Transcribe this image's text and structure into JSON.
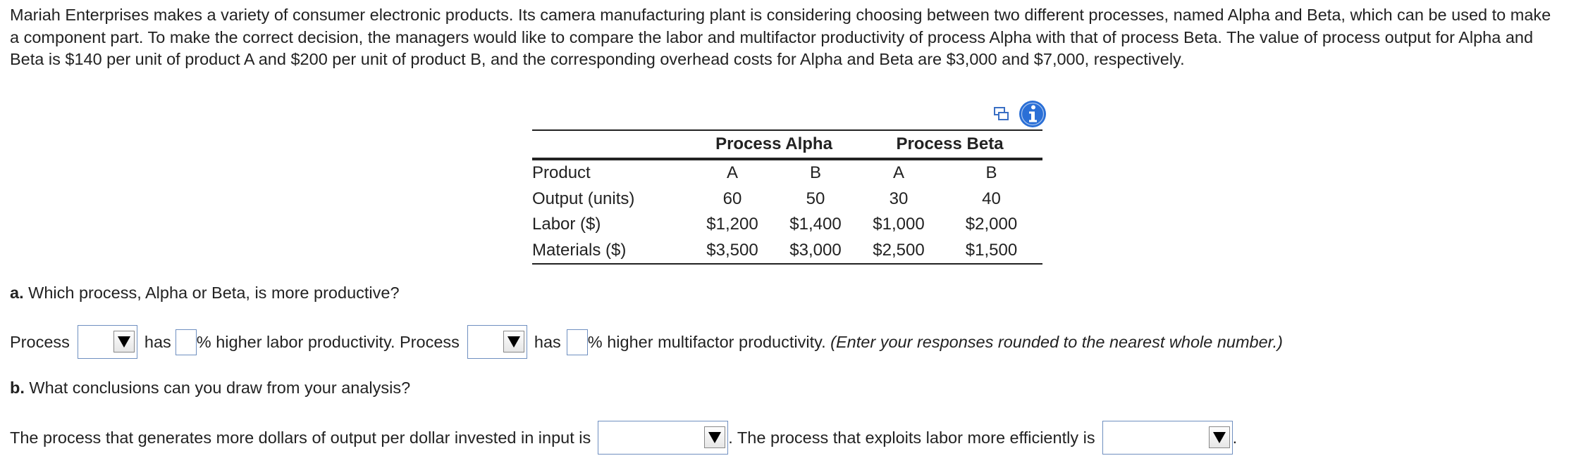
{
  "problem": {
    "text": "Mariah Enterprises makes a variety of consumer electronic products. Its camera manufacturing plant is considering choosing between two different processes, named Alpha and Beta, which can be used to make a component part. To make the correct decision, the managers would like to compare the labor and multifactor productivity of process Alpha with that of process Beta. The value of process output for Alpha and Beta is $140 per unit of product A and $200 per unit of product B, and the corresponding overhead costs for Alpha and Beta are $3,000 and $7,000, respectively."
  },
  "icons": {
    "copy": "copy-icon",
    "info": "info-icon",
    "info_color": "#2a6fd6"
  },
  "table": {
    "group_headers": [
      "Process Alpha",
      "Process Beta"
    ],
    "rows": [
      {
        "label": "Product",
        "values": [
          "A",
          "B",
          "A",
          "B"
        ]
      },
      {
        "label": "Output (units)",
        "values": [
          "60",
          "50",
          "30",
          "40"
        ]
      },
      {
        "label": "Labor ($)",
        "values": [
          "$1,200",
          "$1,400",
          "$1,000",
          "$2,000"
        ]
      },
      {
        "label": "Materials ($)",
        "values": [
          "$3,500",
          "$3,000",
          "$2,500",
          "$1,500"
        ]
      }
    ]
  },
  "part_a": {
    "letter": "a.",
    "question": " Which process, Alpha or Beta, is more productive?",
    "word_process_1": "Process",
    "word_has_1": "has",
    "text_labor": "% higher labor productivity. Process",
    "word_has_2": "has",
    "text_multifactor": "% higher multifactor productivity. ",
    "instruction": "(Enter your responses rounded to the nearest whole number.)",
    "process_select_1": "",
    "labor_percent_value": "",
    "process_select_2": "",
    "multifactor_percent_value": ""
  },
  "part_b": {
    "letter": "b.",
    "question": " What conclusions can you draw from your analysis?",
    "text_1": "The process that generates more dollars of output per dollar invested in input is",
    "text_2": ". The process that exploits labor more efficiently is",
    "text_end": ".",
    "select_1": "",
    "select_2": ""
  }
}
